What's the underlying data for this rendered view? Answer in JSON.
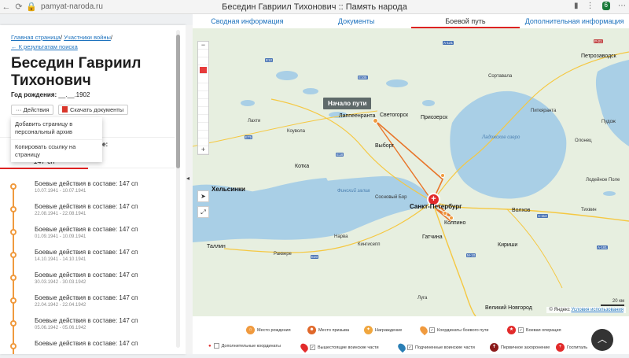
{
  "browser": {
    "url": "pamyat-naroda.ru",
    "title": "Беседин Гавриил Тихонович :: Память народа",
    "profile_badge": "6"
  },
  "top_tabs": [
    {
      "label": "Сводная информация"
    },
    {
      "label": "Документы"
    },
    {
      "label": "Боевой путь"
    },
    {
      "label": "Дополнительная информация"
    }
  ],
  "breadcrumb": {
    "home": "Главная страница",
    "sep": "/",
    "participants": "Участники войны",
    "back": "← К результатам поиска"
  },
  "person": {
    "name": "Беседин Гавриил Тихонович",
    "birth_label": "Год рождения:",
    "birth_value": "__.__.1902"
  },
  "actions": {
    "actions_label": "··· Действия",
    "download_label": "Скачать документы",
    "menu": [
      {
        "label": "Добавить страницу в персональный архив"
      },
      {
        "label": "Копировать ссылку на страницу"
      }
    ]
  },
  "section": {
    "label_suffix": "е:",
    "selected": "147 сп"
  },
  "timeline": [
    {
      "title": "Боевые действия в составе: 147 сп",
      "dates": "10.07.1941 - 10.07.1941"
    },
    {
      "title": "Боевые действия в составе: 147 сп",
      "dates": "22.08.1941 - 22.08.1941"
    },
    {
      "title": "Боевые действия в составе: 147 сп",
      "dates": "01.09.1941 - 10.09.1941"
    },
    {
      "title": "Боевые действия в составе: 147 сп",
      "dates": "14.10.1941 - 14.10.1941"
    },
    {
      "title": "Боевые действия в составе: 147 сп",
      "dates": "30.03.1942 - 30.03.1942"
    },
    {
      "title": "Боевые действия в составе: 147 сп",
      "dates": "22.04.1942 - 22.04.1942"
    },
    {
      "title": "Боевые действия в составе: 147 сп",
      "dates": "05.06.1942 - 05.06.1942"
    },
    {
      "title": "Боевые действия в составе: 147 сп",
      "dates": ""
    }
  ],
  "map": {
    "tooltip": "Начало пути",
    "cities": {
      "spb": "Санкт-Петербург",
      "helsinki": "Хельсинки",
      "tallinn": "Таллин",
      "petrozavodsk": "Петрозаводск",
      "vyborg": "Выборг",
      "kotka": "Котка",
      "lappeenranta": "Лаппеенранта",
      "svetogorsk": "Светогорск",
      "priozersk": "Приозерск",
      "gatchina": "Гатчина",
      "kolpino": "Колпино",
      "kirishi": "Кириши",
      "volkhov": "Волхов",
      "vnovgorod": "Великий Новгород",
      "lahti": "Лахти",
      "kouvola": "Коувола",
      "sosnovy_bor": "Сосновый Бор",
      "narva": "Нарва",
      "rakvere": "Раквере",
      "kingisepp": "Кингисепп",
      "tikhvin": "Тихвин",
      "pitkyaranta": "Питкяранта",
      "sortavala": "Сортавала",
      "olonets": "Олонец",
      "lodeynoe": "Лодейное Поле",
      "luga": "Луга",
      "pudozh": "Пудож"
    },
    "water": {
      "ladoga": "Ладожское озеро",
      "finnish_gulf": "Финский залив"
    },
    "roads": [
      "A-121",
      "E18",
      "E75",
      "A-114",
      "M-10",
      "E20",
      "E105",
      "P-21",
      "A-181",
      "E12"
    ],
    "copyright": "© Яндекс",
    "terms": "Условия использования",
    "scale": "20 км"
  },
  "legend": {
    "items": [
      {
        "label": "Место рождения",
        "color": "#f09a3e"
      },
      {
        "label": "Место призыва",
        "color": "#e0682a"
      },
      {
        "label": "Награждение",
        "color": "#f0a63e"
      },
      {
        "label": "Координаты боевого пути",
        "color": "#f09a3e"
      },
      {
        "label": "Боевая операция",
        "color": "#e22b2b"
      },
      {
        "label": "Дополнительные координаты",
        "color": "#e22b2b"
      },
      {
        "label": "Вышестоящие воинские части",
        "color": "#e22b2b"
      },
      {
        "label": "Подчиненные воинские части",
        "color": "#2a7fb5"
      },
      {
        "label": "Первичное захоронение",
        "color": "#8b1a1a"
      },
      {
        "label": "Госпиталь",
        "color": "#e22b2b"
      }
    ]
  }
}
